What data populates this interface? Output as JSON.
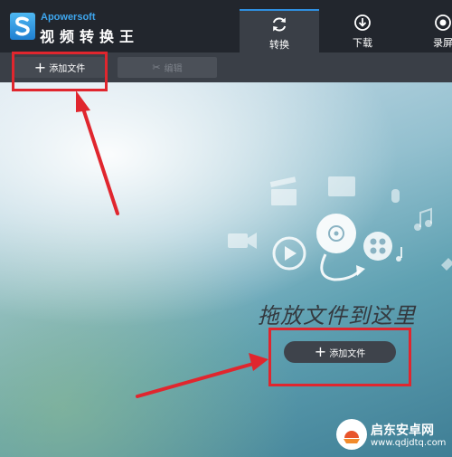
{
  "app": {
    "brand": "Apowersoft",
    "name": "视频转换王"
  },
  "nav": {
    "tabs": [
      {
        "label": "转换",
        "icon": "refresh-icon",
        "active": true
      },
      {
        "label": "下载",
        "icon": "download-icon",
        "active": false
      },
      {
        "label": "录屏",
        "icon": "record-icon",
        "active": false
      }
    ]
  },
  "toolbar": {
    "add_file_label": "添加文件",
    "edit_label": "编辑"
  },
  "stage": {
    "drop_text": "拖放文件到这里",
    "add_file_label": "添加文件"
  },
  "watermark": {
    "line1": "启东安卓网",
    "line2": "www.qdjdtq.com"
  },
  "colors": {
    "accent": "#2f8fe0",
    "annotation": "#e0262e",
    "titlebar": "#22262d",
    "toolbar": "#3a3f47"
  }
}
